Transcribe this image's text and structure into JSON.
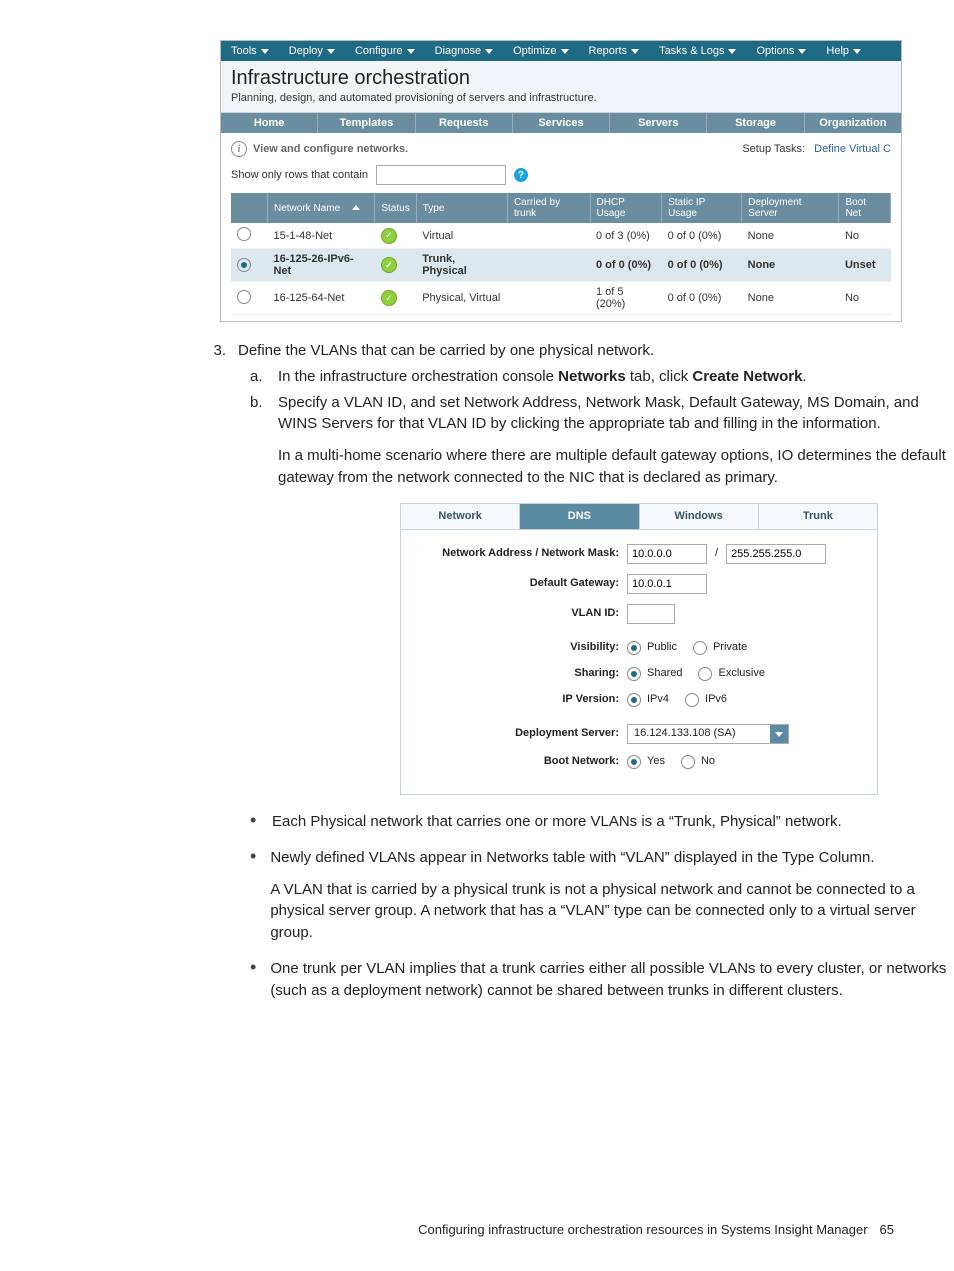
{
  "menus": [
    "Tools",
    "Deploy",
    "Configure",
    "Diagnose",
    "Optimize",
    "Reports",
    "Tasks & Logs",
    "Options",
    "Help"
  ],
  "title": "Infrastructure orchestration",
  "subtitle": "Planning, design, and automated provisioning of servers and infrastructure.",
  "maintabs": [
    "Home",
    "Templates",
    "Requests",
    "Services",
    "Servers",
    "Storage",
    "Organization"
  ],
  "viewcfg": "View and configure networks.",
  "filter_label": "Show only rows that contain",
  "filter_value": "",
  "setup_label": "Setup Tasks:",
  "setup_link": "Define Virtual C",
  "cols": [
    "",
    "Network Name",
    "Status",
    "Type",
    "Carried by trunk",
    "DHCP Usage",
    "Static IP Usage",
    "Deployment Server",
    "Boot Net"
  ],
  "rows": [
    {
      "sel": false,
      "name": "15-1-48-Net",
      "type": "Virtual",
      "trunk": "",
      "dhcp": "0 of 3 (0%)",
      "static": "0 of 0 (0%)",
      "deploy": "None",
      "boot": "No"
    },
    {
      "sel": true,
      "name": "16-125-26-IPv6-Net",
      "type": "Trunk, Physical",
      "trunk": "",
      "dhcp": "0 of 0 (0%)",
      "static": "0 of 0 (0%)",
      "deploy": "None",
      "boot": "Unset"
    },
    {
      "sel": false,
      "name": "16-125-64-Net",
      "type": "Physical, Virtual",
      "trunk": "",
      "dhcp": "1 of 5 (20%)",
      "static": "0 of 0 (0%)",
      "deploy": "None",
      "boot": "No"
    }
  ],
  "step_no": "3.",
  "step_text": "Define the VLANs that can be carried by one physical network.",
  "sub_a_l": "a.",
  "sub_a_1": "In the infrastructure orchestration console ",
  "sub_a_b1": "Networks",
  "sub_a_2": " tab, click ",
  "sub_a_b2": "Create Network",
  "sub_a_3": ".",
  "sub_b_l": "b.",
  "sub_b": "Specify a VLAN ID, and set Network Address, Network Mask, Default Gateway, MS Domain, and WINS Servers for that VLAN ID by clicking the appropriate tab and filling in the information.",
  "para_mh": "In a multi-home scenario where there are multiple default gateway options, IO determines the default gateway from the network connected to the NIC that is declared as primary.",
  "ftabs": [
    "Network",
    "DNS",
    "Windows",
    "Trunk"
  ],
  "ftab_active": 1,
  "form": {
    "addr_label": "Network Address / Network Mask:",
    "addr": "10.0.0.0",
    "mask": "255.255.255.0",
    "gw_label": "Default Gateway:",
    "gw": "10.0.0.1",
    "vlan_label": "VLAN ID:",
    "vlan": "",
    "vis_label": "Visibility:",
    "vis": [
      "Public",
      "Private"
    ],
    "vis_sel": 0,
    "share_label": "Sharing:",
    "share": [
      "Shared",
      "Exclusive"
    ],
    "share_sel": 0,
    "ipver_label": "IP Version:",
    "ipver": [
      "IPv4",
      "IPv6"
    ],
    "ipver_sel": 0,
    "dep_label": "Deployment Server:",
    "dep": "16.124.133.108 (SA)",
    "boot_label": "Boot Network:",
    "boot": [
      "Yes",
      "No"
    ],
    "boot_sel": 0
  },
  "bul1": "Each Physical network that carries one or more VLANs is a “Trunk, Physical” network.",
  "bul2": "Newly defined VLANs appear in Networks table with “VLAN” displayed in the Type Column.",
  "bul2p": "A VLAN that is carried by a physical trunk is not a physical network and cannot be connected to a physical server group. A network that has a “VLAN” type can be connected only to a virtual server group.",
  "bul3": "One trunk per VLAN implies that a trunk carries either all possible VLANs to every cluster, or networks (such as a deployment network) cannot be shared between trunks in different clusters.",
  "foot": "Configuring infrastructure orchestration resources in Systems Insight Manager",
  "pageno": "65"
}
